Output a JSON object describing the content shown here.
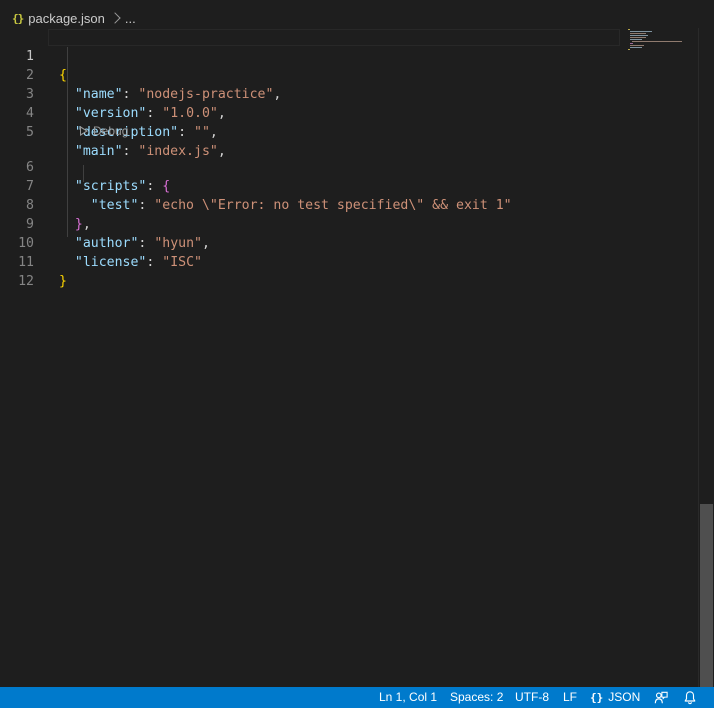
{
  "breadcrumb": {
    "file_icon": "{}",
    "file_name": "package.json",
    "more": "..."
  },
  "editor": {
    "active_line": 1,
    "codelens_label": "Debug",
    "lines": [
      {
        "n": "1"
      },
      {
        "n": "2"
      },
      {
        "n": "3"
      },
      {
        "n": "4"
      },
      {
        "n": "5"
      },
      {
        "n": "6"
      },
      {
        "n": "7"
      },
      {
        "n": "8"
      },
      {
        "n": "9"
      },
      {
        "n": "10"
      },
      {
        "n": "11"
      },
      {
        "n": "12"
      }
    ],
    "tokens": {
      "l1_brace": "{",
      "l2_key": "\"name\"",
      "l2_colon": ": ",
      "l2_val": "\"nodejs-practice\"",
      "l2_comma": ",",
      "l3_key": "\"version\"",
      "l3_colon": ": ",
      "l3_val": "\"1.0.0\"",
      "l3_comma": ",",
      "l4_key": "\"description\"",
      "l4_colon": ": ",
      "l4_val": "\"\"",
      "l4_comma": ",",
      "l5_key": "\"main\"",
      "l5_colon": ": ",
      "l5_val": "\"index.js\"",
      "l5_comma": ",",
      "l6_key": "\"scripts\"",
      "l6_colon": ": ",
      "l6_brace": "{",
      "l7_key": "\"test\"",
      "l7_colon": ": ",
      "l7_val": "\"echo \\\"Error: no test specified\\\" && exit 1\"",
      "l8_brace": "}",
      "l8_comma": ",",
      "l9_key": "\"author\"",
      "l9_colon": ": ",
      "l9_val": "\"hyun\"",
      "l9_comma": ",",
      "l10_key": "\"license\"",
      "l10_colon": ": ",
      "l10_val": "\"ISC\"",
      "l11_brace": "}"
    }
  },
  "statusbar": {
    "position": "Ln 1, Col 1",
    "indentation": "Spaces: 2",
    "encoding": "UTF-8",
    "eol": "LF",
    "language_icon": "{}",
    "language": "JSON",
    "feedback_icon": "feedback-icon",
    "bell_icon": "bell-icon"
  },
  "colors": {
    "editor_bg": "#1e1e1e",
    "statusbar_bg": "#007acc",
    "key": "#9cdcfe",
    "string": "#ce9178",
    "bracket_level1": "#ffd700",
    "bracket_level2": "#da70d6"
  }
}
